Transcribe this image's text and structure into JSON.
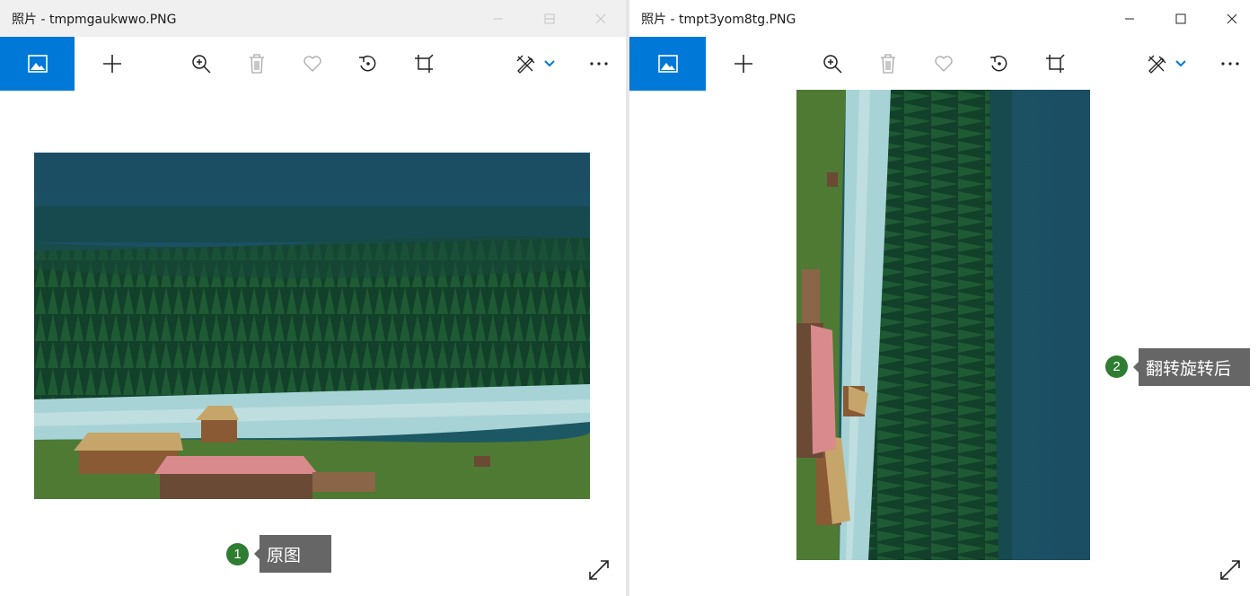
{
  "windows": [
    {
      "title": "照片 - tmpmgaukwwo.PNG",
      "callout": {
        "number": "1",
        "label": "原图"
      }
    },
    {
      "title": "照片 - tmpt3yom8tg.PNG",
      "callout": {
        "number": "2",
        "label": "翻转旋转后"
      }
    }
  ],
  "toolbar_icons": [
    "picture-icon",
    "add-icon",
    "zoom-in-icon",
    "delete-icon",
    "favorite-icon",
    "rotate-icon",
    "crop-icon",
    "edit-create-icon",
    "chevron-down-icon",
    "more-icon"
  ],
  "colors": {
    "accent": "#0078d7",
    "callout_number": "#2e7d32",
    "callout_box": "#666666"
  }
}
